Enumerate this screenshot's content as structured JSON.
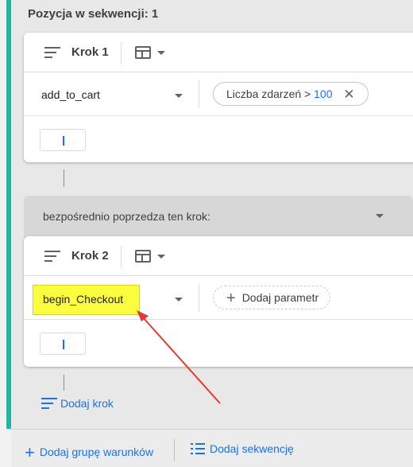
{
  "sequence_title": "Pozycja w sekwencji: 1",
  "steps": [
    {
      "label": "Krok 1",
      "event": "add_to_cart",
      "chip_text": "Liczba zdarzeń >",
      "chip_value": "100"
    },
    {
      "label": "Krok 2",
      "event": "begin_Checkout",
      "add_param_label": "Dodaj parametr"
    }
  ],
  "condition_label": "bezpośrednio poprzedza ten krok:",
  "add_step_label": "Dodaj krok",
  "footer": {
    "add_group_label": "Dodaj grupę warunków",
    "add_sequence_label": "Dodaj sekwencję"
  },
  "colors": {
    "accent": "#1fb5a0",
    "link": "#1a73e8",
    "highlight": "#fdfd3f",
    "annotation_arrow": "#e53935"
  }
}
